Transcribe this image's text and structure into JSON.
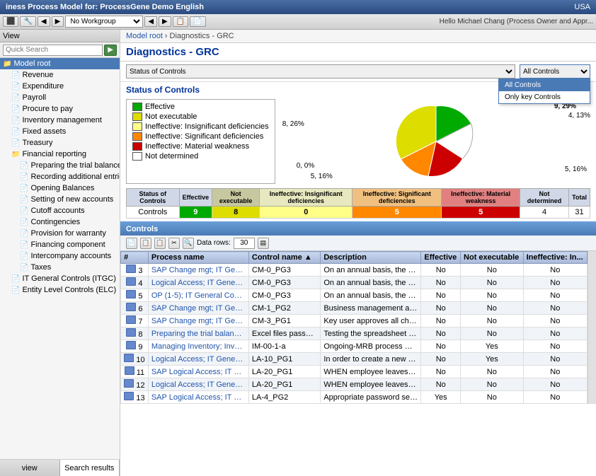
{
  "titlebar": {
    "title": "iness Process Model for: ProcessGene Demo English",
    "region": "USA",
    "hello": "Hello Michael Chang (Process Owner and Appr..."
  },
  "toolbar": {
    "workgroup": "No Workgroup"
  },
  "sidebar": {
    "quick_search_placeholder": "Quick Search",
    "model_root": "Model root",
    "items": [
      {
        "label": "Revenue",
        "indent": 1
      },
      {
        "label": "Expenditure",
        "indent": 1
      },
      {
        "label": "Payroll",
        "indent": 1
      },
      {
        "label": "Procure to pay",
        "indent": 1
      },
      {
        "label": "Inventory management",
        "indent": 1
      },
      {
        "label": "Fixed assets",
        "indent": 1
      },
      {
        "label": "Treasury",
        "indent": 1
      },
      {
        "label": "Financial reporting",
        "indent": 1
      },
      {
        "label": "Preparing the trial balance",
        "indent": 2
      },
      {
        "label": "Recording additional entries",
        "indent": 2
      },
      {
        "label": "Opening Balances",
        "indent": 2
      },
      {
        "label": "Setting of new accounts",
        "indent": 2
      },
      {
        "label": "Cutoff accounts",
        "indent": 2
      },
      {
        "label": "Contingencies",
        "indent": 2
      },
      {
        "label": "Provision for warranty",
        "indent": 2
      },
      {
        "label": "Financing component",
        "indent": 2
      },
      {
        "label": "Intercompany accounts",
        "indent": 2
      },
      {
        "label": "Taxes",
        "indent": 2
      },
      {
        "label": "IT General Controls (ITGC)",
        "indent": 1
      },
      {
        "label": "Entity Level Controls (ELC)",
        "indent": 1
      }
    ],
    "tabs": [
      {
        "label": "view"
      },
      {
        "label": "Search results"
      }
    ]
  },
  "breadcrumb": {
    "root": "Model root",
    "separator": " › ",
    "current": "Diagnostics - GRC"
  },
  "page": {
    "title": "Diagnostics - GRC",
    "status_dropdown_label": "Status of Controls",
    "controls_filter": "All Controls",
    "filter_options": [
      "All Controls",
      "Only key Controls"
    ]
  },
  "status_of_controls": {
    "title": "Status of Controls",
    "legend": [
      {
        "color": "#00aa00",
        "label": "Effective"
      },
      {
        "color": "#dddd00",
        "label": "Not executable"
      },
      {
        "color": "#ffff88",
        "label": "Ineffective: Insignificant deficiencies"
      },
      {
        "color": "#ff8800",
        "label": "Ineffective: Significant deficiencies"
      },
      {
        "color": "#cc0000",
        "label": "Ineffective: Material weakness"
      },
      {
        "color": "#ffffff",
        "label": "Not determined"
      }
    ],
    "pie": {
      "segments": [
        {
          "label": "9, 29%",
          "color": "#00aa00",
          "value": 29
        },
        {
          "label": "4, 13%",
          "color": "#ffffff",
          "value": 13
        },
        {
          "label": "5, 16%",
          "color": "#cc0000",
          "value": 16
        },
        {
          "label": "5, 16%",
          "color": "#ff8800",
          "value": 16
        },
        {
          "label": "0, 0%",
          "color": "#ffff88",
          "value": 0
        },
        {
          "label": "8, 26%",
          "color": "#dddd00",
          "value": 26
        }
      ]
    }
  },
  "summary_table": {
    "headers": [
      "Status of Controls",
      "Effective",
      "Not executable",
      "Ineffective: Insignificant deficiencies",
      "Ineffective: Significant deficiencies",
      "Ineffective: Material weakness",
      "Not determined",
      "Total"
    ],
    "row_label": "Controls",
    "values": [
      "9",
      "8",
      "0",
      "5",
      "5",
      "4",
      "31"
    ]
  },
  "controls_section": {
    "title": "Controls",
    "data_rows_label": "Data rows:",
    "data_rows_value": "30",
    "table_headers": [
      "#",
      "Process name",
      "Control name ▲",
      "Description",
      "Effective",
      "Not executable",
      "Ineffective: In..."
    ],
    "rows": [
      {
        "num": "3",
        "process": "SAP Change mgt; IT Genera...",
        "control": "CM-0_PG3",
        "desc": "On an annual basis, the IT man...",
        "effective": "No",
        "not_exec": "No",
        "ineffective": "No"
      },
      {
        "num": "4",
        "process": "Logical Access; IT General ...",
        "control": "CM-0_PG3",
        "desc": "On an annual basis, the IT man...",
        "effective": "No",
        "not_exec": "No",
        "ineffective": "No"
      },
      {
        "num": "5",
        "process": "OP (1-5); IT General Contro...",
        "control": "CM-0_PG3",
        "desc": "On an annual basis, the IT man...",
        "effective": "No",
        "not_exec": "No",
        "ineffective": "No"
      },
      {
        "num": "6",
        "process": "SAP Change mgt; IT Genera...",
        "control": "CM-1_PG2",
        "desc": "Business management authori...",
        "effective": "No",
        "not_exec": "No",
        "ineffective": "No"
      },
      {
        "num": "7",
        "process": "SAP Change mgt; IT Genera...",
        "control": "CM-3_PG1",
        "desc": "Key user approves all change...",
        "effective": "No",
        "not_exec": "No",
        "ineffective": "No"
      },
      {
        "num": "8",
        "process": "Preparing the trial balance; ...",
        "control": "Excel files password ...",
        "desc": "Testing the spreadsheet protect...",
        "effective": "No",
        "not_exec": "No",
        "ineffective": "No"
      },
      {
        "num": "9",
        "process": "Managing Inventory; Invent...",
        "control": "IM-00-1-a",
        "desc": "Ongoing-MRB process manag...",
        "effective": "No",
        "not_exec": "Yes",
        "ineffective": "No"
      },
      {
        "num": "10",
        "process": "Logical Access; IT General ...",
        "control": "LA-10_PG1",
        "desc": "In order to create a new user i...",
        "effective": "No",
        "not_exec": "Yes",
        "ineffective": "No"
      },
      {
        "num": "11",
        "process": "SAP Logical Access; IT Gene...",
        "control": "LA-20_PG1",
        "desc": "WHEN employee leaves the co...",
        "effective": "No",
        "not_exec": "No",
        "ineffective": "No"
      },
      {
        "num": "12",
        "process": "Logical Access; IT General ...",
        "control": "LA-20_PG1",
        "desc": "WHEN employee leaves the co...",
        "effective": "No",
        "not_exec": "No",
        "ineffective": "No"
      },
      {
        "num": "13",
        "process": "SAP Logical Access; IT Gene...",
        "control": "LA-4_PG2",
        "desc": "Appropriate password setting...",
        "effective": "Yes",
        "not_exec": "No",
        "ineffective": "No"
      }
    ]
  },
  "colors": {
    "accent_blue": "#003399",
    "header_blue": "#4a7ab5",
    "green": "#00aa00",
    "yellow": "#dddd00",
    "light_yellow": "#ffff88",
    "orange": "#ff8800",
    "red": "#cc0000"
  }
}
